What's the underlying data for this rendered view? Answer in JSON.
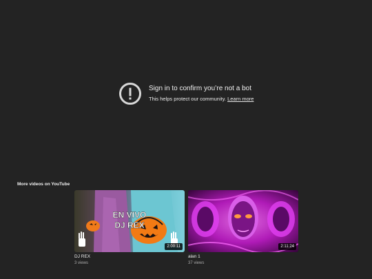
{
  "notice": {
    "icon": "alert-circle-icon",
    "title": "Sign in to confirm you’re not a bot",
    "subtitle": "This helps protect our community.",
    "link_label": "Learn more"
  },
  "more_videos": {
    "heading": "More videos on YouTube",
    "videos": [
      {
        "title": "DJ REX",
        "views": "3 views",
        "duration": "2:00:11",
        "thumbnail_text": [
          "EN VIVO",
          "DJ REX"
        ]
      },
      {
        "title": "alan 1",
        "views": "37 views",
        "duration": "2:11:24"
      }
    ]
  },
  "colors": {
    "background": "#232323",
    "text_primary": "#f1f1f1",
    "text_secondary": "#aaaaaa",
    "thumb2_accent": "#c81fd1"
  }
}
